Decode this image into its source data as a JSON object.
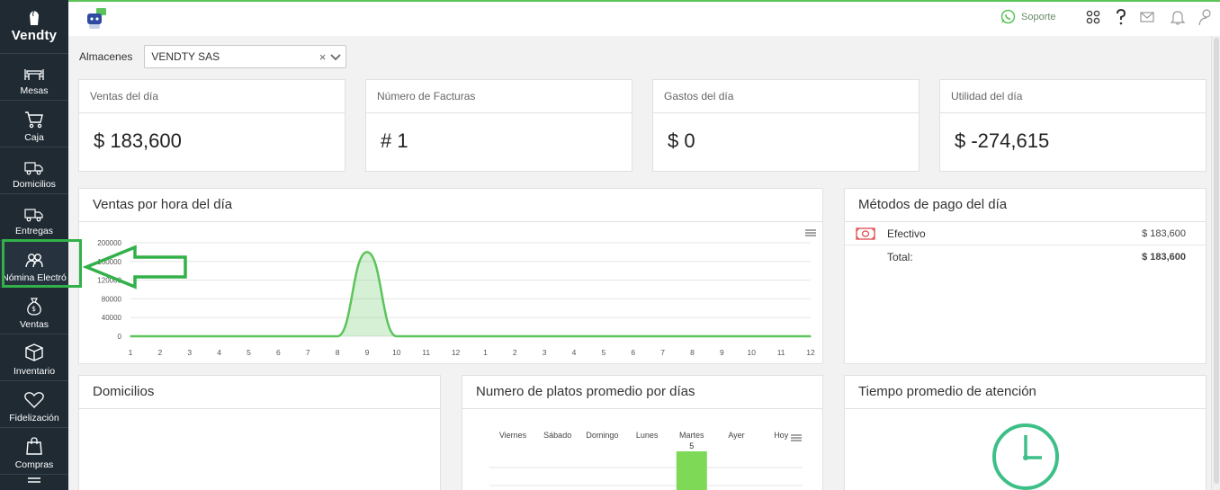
{
  "app": {
    "brand": "Vendty"
  },
  "sidebar": {
    "items": [
      {
        "label": "Mesas",
        "icon": "tables-icon"
      },
      {
        "label": "Caja",
        "icon": "cart-icon"
      },
      {
        "label": "Domicilios",
        "icon": "delivery-truck-icon"
      },
      {
        "label": "Entregas",
        "icon": "delivery-truck-icon"
      },
      {
        "label": "Nómina Electró",
        "icon": "users-icon"
      },
      {
        "label": "Ventas",
        "icon": "money-bag-icon"
      },
      {
        "label": "Inventario",
        "icon": "box-icon"
      },
      {
        "label": "Fidelización",
        "icon": "heart-icon"
      },
      {
        "label": "Compras",
        "icon": "shopping-bag-icon"
      }
    ]
  },
  "topbar": {
    "support_label": "Soporte"
  },
  "filter": {
    "label": "Almacenes",
    "selected": "VENDTY SAS"
  },
  "stats": [
    {
      "title": "Ventas del día",
      "value": "$ 183,600"
    },
    {
      "title": "Número de Facturas",
      "value": "# 1"
    },
    {
      "title": "Gastos del día",
      "value": "$ 0"
    },
    {
      "title": "Utilidad del día",
      "value": "$ -274,615"
    }
  ],
  "panels": {
    "hourly": {
      "title": "Ventas por hora del día"
    },
    "payments": {
      "title": "Métodos de pago del día",
      "rows": [
        {
          "label": "Efectivo",
          "amount": "$ 183,600"
        },
        {
          "label": "Total:",
          "amount": "$ 183,600"
        }
      ]
    },
    "deliveries": {
      "title": "Domicilios"
    },
    "dishes": {
      "title": "Numero de platos promedio por días"
    },
    "attention": {
      "title": "Tiempo promedio de atención"
    }
  },
  "colors": {
    "accent": "#5cc45a",
    "sidebar": "#1f2a33",
    "highlight": "#32b14a"
  },
  "chart_data": [
    {
      "type": "area",
      "title": "Ventas por hora del día",
      "categories": [
        "1",
        "2",
        "3",
        "4",
        "5",
        "6",
        "7",
        "8",
        "9",
        "10",
        "11",
        "12",
        "1",
        "2",
        "3",
        "4",
        "5",
        "6",
        "7",
        "8",
        "9",
        "10",
        "11",
        "12"
      ],
      "values": [
        0,
        0,
        0,
        0,
        0,
        0,
        0,
        0,
        180000,
        0,
        0,
        0,
        0,
        0,
        0,
        0,
        0,
        0,
        0,
        0,
        0,
        0,
        0,
        0
      ],
      "yticks": [
        "0",
        "40000",
        "80000",
        "120000",
        "160000",
        "200000"
      ],
      "ylim": [
        0,
        200000
      ]
    },
    {
      "type": "bar",
      "title": "Numero de platos promedio por días",
      "categories": [
        "Viernes",
        "Sábado",
        "Domingo",
        "Lunes",
        "Martes",
        "Ayer",
        "Hoy"
      ],
      "values": [
        0,
        0,
        0,
        0,
        5,
        0,
        0
      ],
      "data_labels": [
        "",
        "",
        "",
        "",
        "5",
        "",
        ""
      ]
    }
  ]
}
